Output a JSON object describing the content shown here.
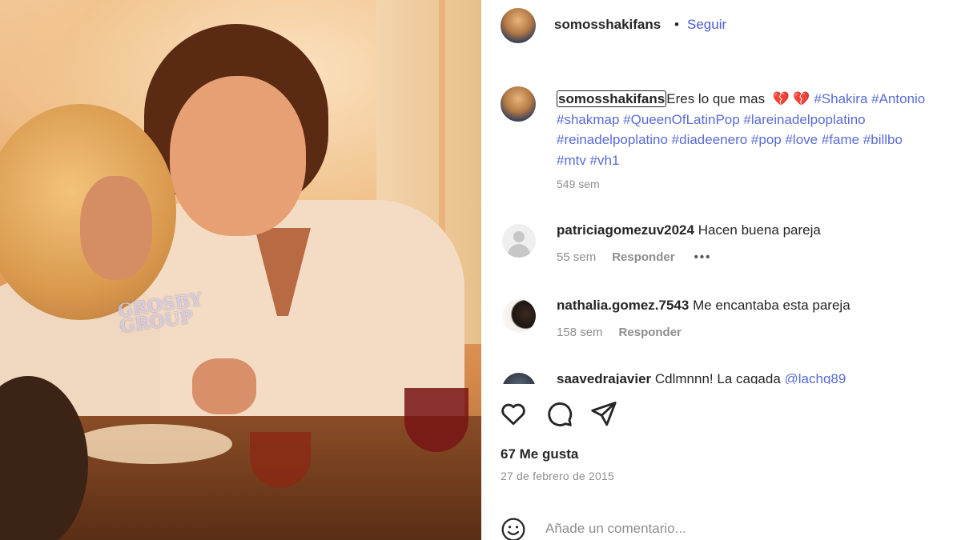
{
  "post_image": {
    "watermark_line1": "GROSBY",
    "watermark_line2": "GROUP"
  },
  "header": {
    "username": "somosshakifans",
    "separator": "•",
    "follow_label": "Seguir"
  },
  "caption": {
    "username": "somosshakifans",
    "text": "Eres lo que mas",
    "emoji": "💔 💔",
    "hashtags_line1": "#Shakira #Antonio",
    "hashtags_line2": "#shakmap #QueenOfLatinPop #lareinadelpoplatino",
    "hashtags_line3": "#reinadelpoplatino #diadeenero #pop #love #fame #billbo",
    "hashtags_line4": "#mtv #vh1",
    "time": "549 sem"
  },
  "comments": [
    {
      "username": "patriciagomezuv2024",
      "text": "Hacen buena pareja",
      "time": "55 sem",
      "reply_label": "Responder",
      "more": "•••"
    },
    {
      "username": "nathalia.gomez.7543",
      "text": "Me encantaba esta pareja",
      "time": "158 sem",
      "reply_label": "Responder"
    },
    {
      "username": "saavedrajavier",
      "text": "Cdlmnnn! La cagada",
      "mention": "@lachg89"
    }
  ],
  "actions": {
    "like_icon": "heart-icon",
    "comment_icon": "comment-icon",
    "share_icon": "share-icon"
  },
  "likes": "67 Me gusta",
  "date": "27 de febrero de 2015",
  "add_comment": {
    "placeholder": "Añade un comentario...",
    "emoji_icon": "smiley-icon"
  },
  "colors": {
    "link": "#4c5bd4",
    "hashtag": "#5a6bd6",
    "muted": "#8e8e8e",
    "text": "#262626"
  }
}
